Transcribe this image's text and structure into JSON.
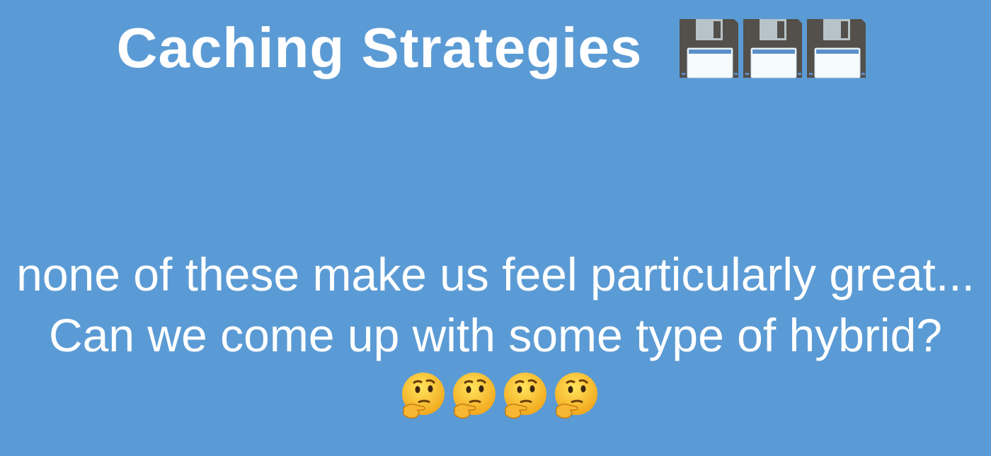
{
  "slide": {
    "title": "Caching Strategies",
    "title_icons": [
      "floppy-disk-icon",
      "floppy-disk-icon",
      "floppy-disk-icon"
    ],
    "body": "none of these make us feel particularly great... Can we come up with some type of hybrid?",
    "body_icons": [
      "thinking-face-icon",
      "thinking-face-icon",
      "thinking-face-icon",
      "thinking-face-icon"
    ],
    "background_color": "#5b9bd5"
  }
}
